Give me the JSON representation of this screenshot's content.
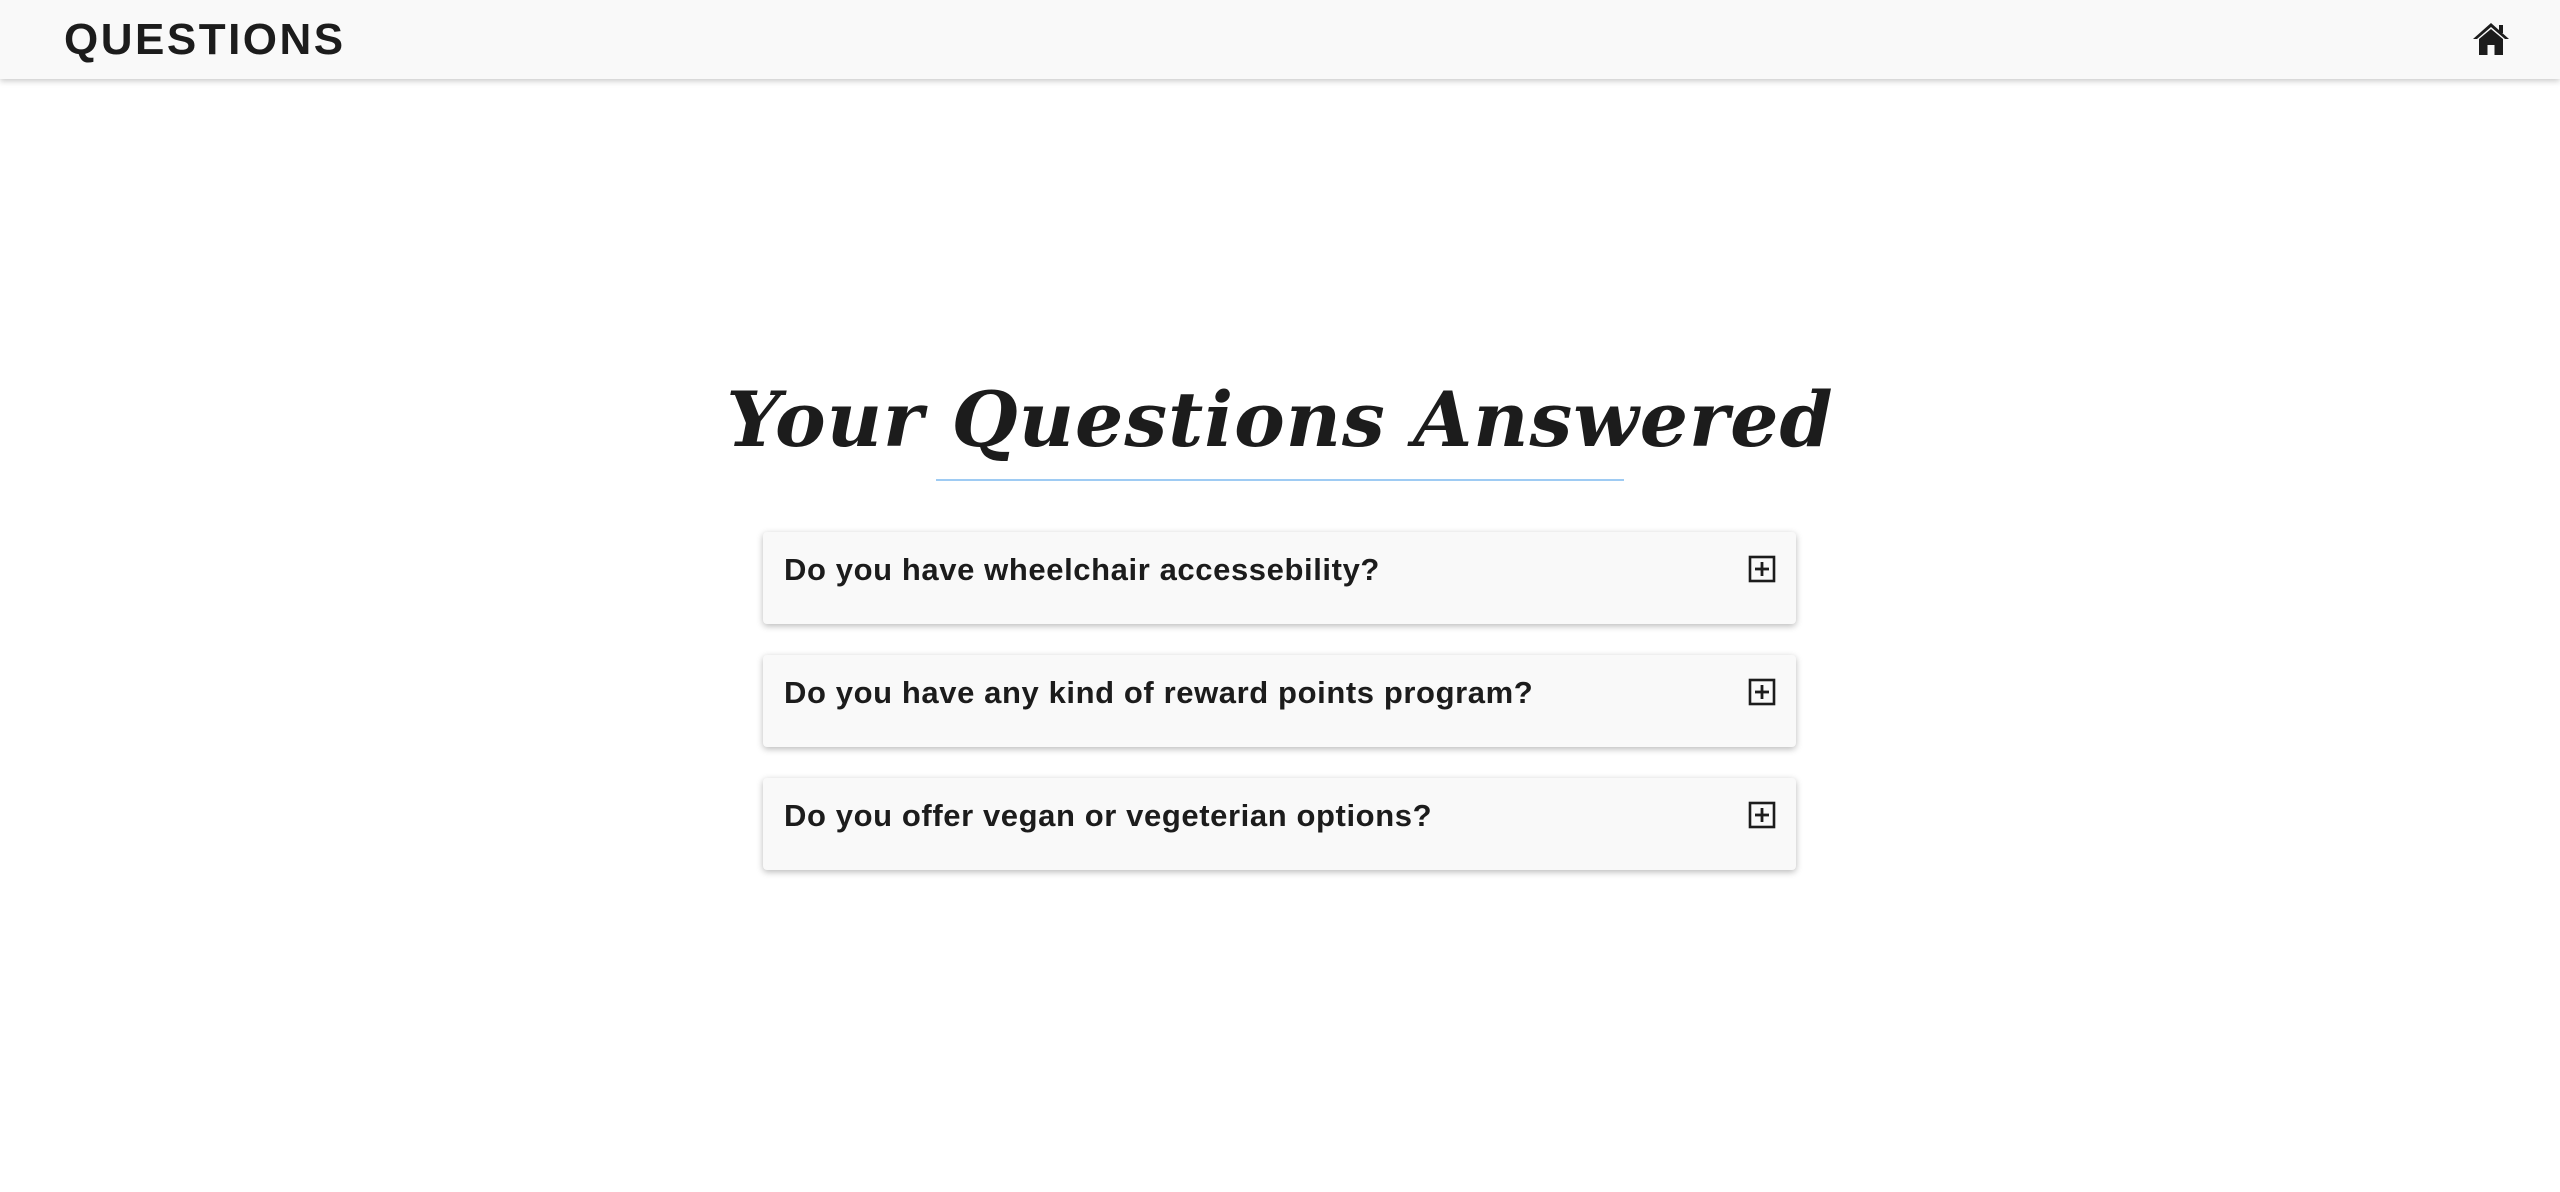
{
  "navbar": {
    "brand": "QUESTIONS",
    "home_icon": "home-icon"
  },
  "main": {
    "title": "Your Questions Answered",
    "accent_color": "#9ecbf3",
    "faqs": [
      {
        "question": "Do you have wheelchair accessebility?",
        "toggle_icon": "plus-square-icon"
      },
      {
        "question": "Do you have any kind of reward points program?",
        "toggle_icon": "plus-square-icon"
      },
      {
        "question": "Do you offer vegan or vegeterian options?",
        "toggle_icon": "plus-square-icon"
      }
    ]
  }
}
